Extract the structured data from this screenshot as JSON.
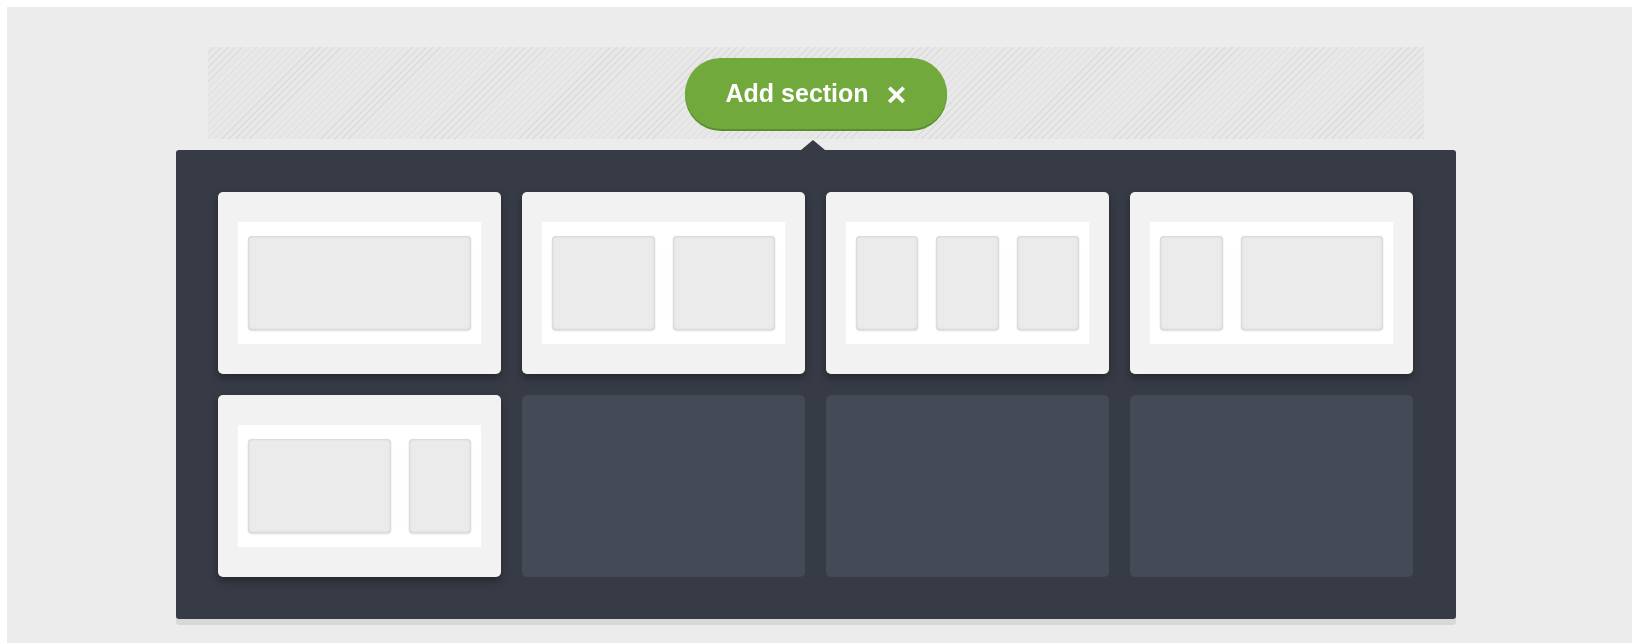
{
  "add_button": {
    "label": "Add section",
    "close": "×"
  },
  "layouts": [
    {
      "kind": "full"
    },
    {
      "kind": "halves"
    },
    {
      "kind": "thirds"
    },
    {
      "kind": "narrow-wide"
    },
    {
      "kind": "wide-narrow"
    },
    {
      "kind": "empty"
    },
    {
      "kind": "empty"
    },
    {
      "kind": "empty"
    }
  ]
}
